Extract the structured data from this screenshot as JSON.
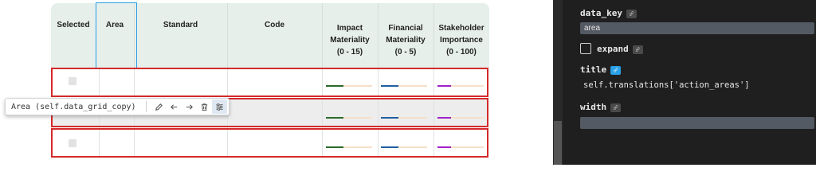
{
  "grid": {
    "headers": [
      {
        "id": "selected",
        "label": "Selected"
      },
      {
        "id": "area",
        "label": "Area"
      },
      {
        "id": "standard",
        "label": "Standard"
      },
      {
        "id": "code",
        "label": "Code"
      },
      {
        "id": "impact",
        "label": "Impact\nMateriality\n(0 - 15)"
      },
      {
        "id": "financial",
        "label": "Financial\nMateriality\n(0 - 5)"
      },
      {
        "id": "stakeholder",
        "label": "Stakeholder\nImportance\n(0 - 100)"
      }
    ],
    "rows": [
      {
        "selected": false,
        "impact": 0.38,
        "financial": 0.38,
        "stakeholder": 0.3
      },
      {
        "selected": false,
        "impact": 0.38,
        "financial": 0.38,
        "stakeholder": 0.3
      },
      {
        "selected": false,
        "impact": 0.38,
        "financial": 0.38,
        "stakeholder": 0.3
      }
    ],
    "colors": {
      "impact": "#2a6a2a",
      "financial": "#1f5fa0",
      "stakeholder": "#a020c8",
      "bar_track": "#f7dfc8",
      "row_outline": "#d42a2a",
      "selection": "#2aa0e6"
    }
  },
  "toolbar": {
    "label": "Area (self.data_grid_copy)",
    "icons": [
      "pencil-icon",
      "arrow-left-icon",
      "arrow-right-icon",
      "trash-icon",
      "sliders-icon"
    ]
  },
  "panel": {
    "data_key_label": "data_key",
    "data_key_value": "area",
    "expand_label": "expand",
    "title_label": "title",
    "title_value": "self.translations['action_areas']",
    "width_label": "width",
    "width_value": ""
  }
}
